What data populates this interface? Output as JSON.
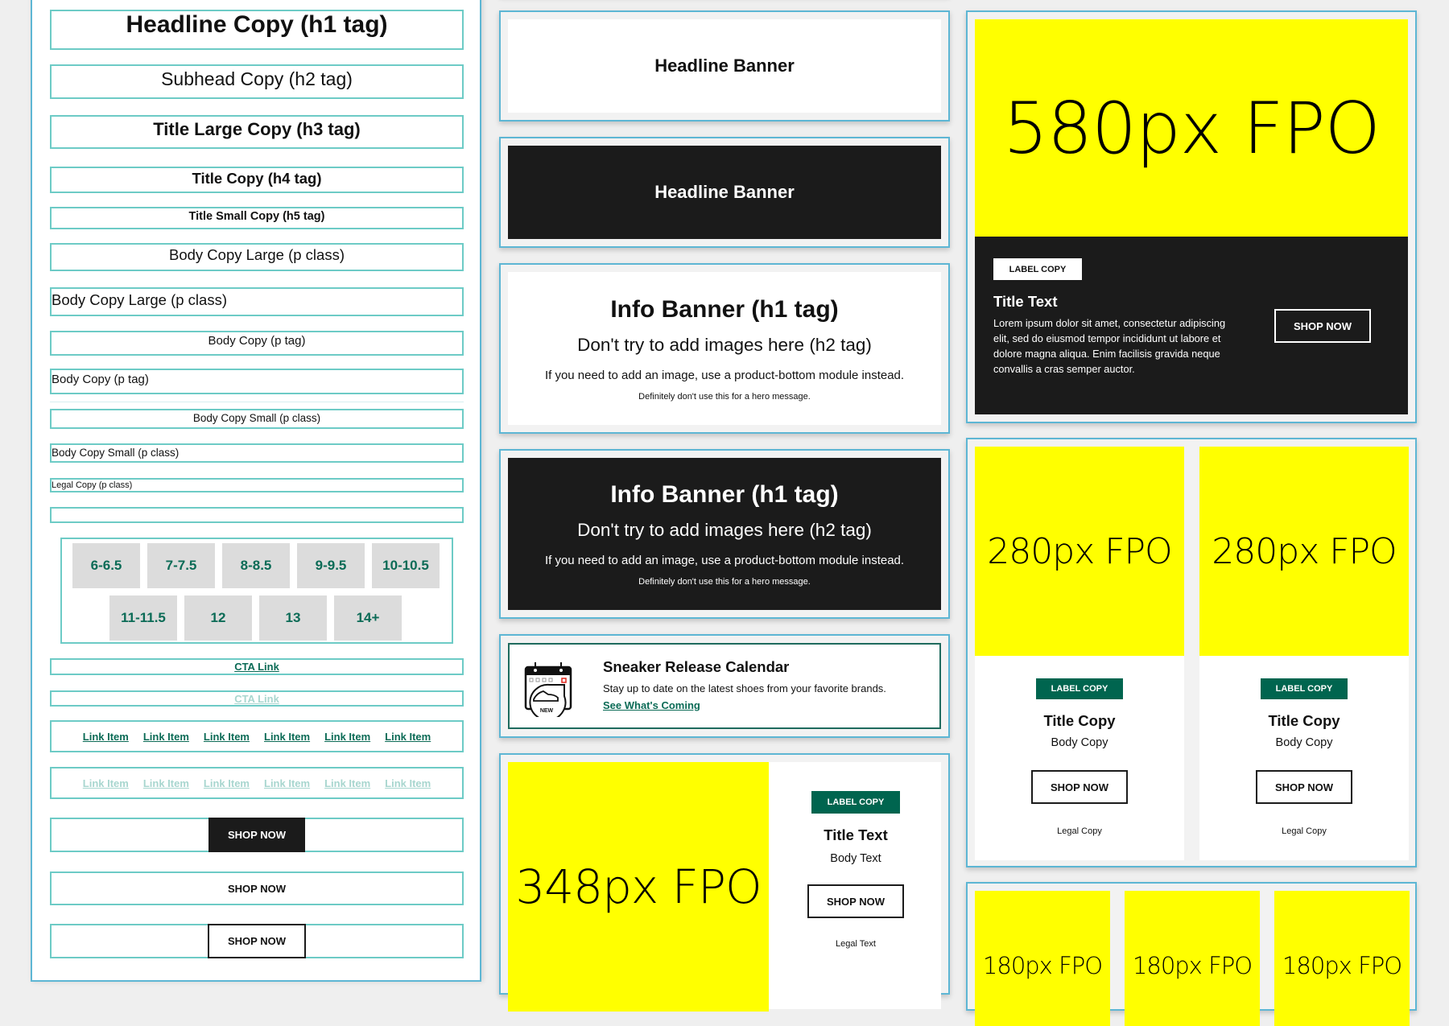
{
  "typography": {
    "h1": "Headline Copy (h1 tag)",
    "h2": "Subhead Copy (h2 tag)",
    "h3": "Title Large Copy (h3 tag)",
    "h4": "Title Copy (h4 tag)",
    "h5": "Title Small Copy (h5 tag)",
    "body_large_center": "Body Copy Large (p class)",
    "body_large_left": "Body Copy Large (p class)",
    "body_center": "Body Copy (p tag)",
    "body_left": "Body Copy (p tag)",
    "body_small_center": "Body Copy Small (p class)",
    "body_small_left": "Body Copy Small (p class)",
    "legal": "Legal Copy (p class)",
    "empty": ""
  },
  "sizes": [
    "6-6.5",
    "7-7.5",
    "8-8.5",
    "9-9.5",
    "10-10.5",
    "11-11.5",
    "12",
    "13",
    "14+"
  ],
  "cta": {
    "link": "CTA Link",
    "link_light": "CTA Link",
    "link_items": [
      "Link Item",
      "Link Item",
      "Link Item",
      "Link Item",
      "Link Item",
      "Link Item"
    ],
    "link_items_light": [
      "Link Item",
      "Link Item",
      "Link Item",
      "Link Item",
      "Link Item",
      "Link Item"
    ],
    "shop_dark": "SHOP NOW",
    "shop_plain": "SHOP NOW",
    "shop_outline": "SHOP NOW"
  },
  "headline_banner_light": "Headline Banner",
  "headline_banner_dark": "Headline Banner",
  "info_banner": {
    "h1": "Info Banner (h1 tag)",
    "h2": "Don't try to add images here (h2 tag)",
    "p": "If you need to add an image, use a product-bottom module instead.",
    "small": "Definitely don't use this for a hero message."
  },
  "sneaker": {
    "title": "Sneaker Release Calendar",
    "body": "Stay up to date on the latest shoes from your favorite brands.",
    "link": "See What's Coming",
    "icon_badge": "NEW"
  },
  "product_348": {
    "fpo": "348px FPO",
    "label": "LABEL COPY",
    "title": "Title Text",
    "body": "Body Text",
    "button": "SHOP NOW",
    "legal": "Legal Text"
  },
  "hero_580": {
    "fpo": "580px FPO",
    "label": "LABEL COPY",
    "title": "Title Text",
    "body": "Lorem ipsum dolor sit amet, consectetur adipiscing elit, sed do eiusmod tempor incididunt ut labore et dolore magna aliqua. Enim facilisis gravida neque convallis a cras semper auctor.",
    "button": "SHOP NOW"
  },
  "cards_280": [
    {
      "fpo": "280px FPO",
      "label": "LABEL COPY",
      "title": "Title Copy",
      "body": "Body Copy",
      "button": "SHOP NOW",
      "legal": "Legal Copy"
    },
    {
      "fpo": "280px FPO",
      "label": "LABEL COPY",
      "title": "Title Copy",
      "body": "Body Copy",
      "button": "SHOP NOW",
      "legal": "Legal Copy"
    }
  ],
  "cards_180": [
    "180px FPO",
    "180px FPO",
    "180px FPO"
  ],
  "colors": {
    "brand_green": "#00654f",
    "link_green": "#0b6b56",
    "fpo_yellow": "#ffff00",
    "dark": "#1b1b1b",
    "guide_teal": "#6dcbc6",
    "module_blue": "#5db6d4"
  }
}
